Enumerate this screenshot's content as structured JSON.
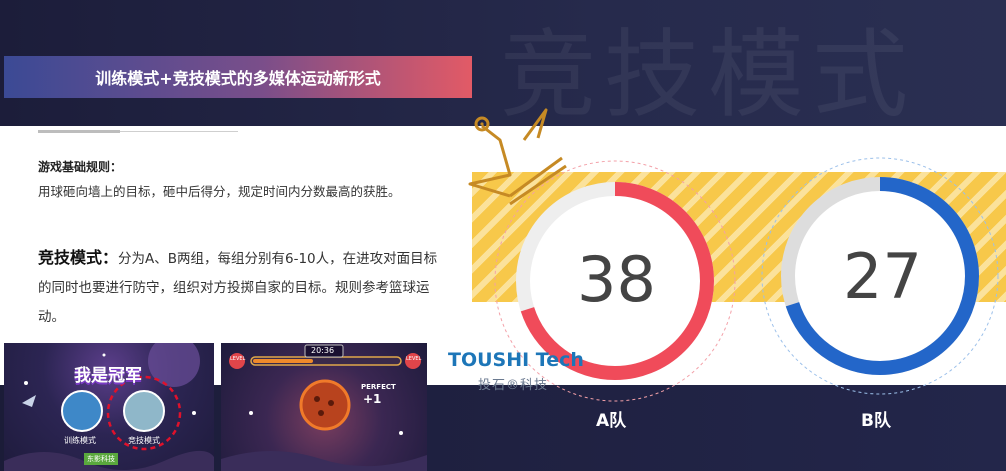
{
  "watermark": "竞技模式",
  "title_banner": "训练模式+竞技模式的多媒体运动新形式",
  "rules": {
    "heading": "游戏基础规则：",
    "body": "用球砸向墙上的目标，砸中后得分，规定时间内分数最高的获胜。"
  },
  "competition": {
    "label": "竞技模式：",
    "text": "分为A、B两组，每组分别有6-10人，在进攻对面目标的同时也要进行防守，组织对方投掷自家的目标。规则参考篮球运动。"
  },
  "thumbnails": {
    "thumb1": {
      "banner": "我是冠军",
      "left_label": "训练模式",
      "right_label": "竞技模式",
      "logo": "东影科技"
    },
    "thumb2": {
      "timer": "20:36",
      "bar_left": "LEVEL",
      "bar_right": "LEVEL",
      "perfect": "PERFECT",
      "bonus": "+1"
    }
  },
  "logo": {
    "en": "TOUSHI Tech",
    "cn": "投石®科技"
  },
  "teams": [
    {
      "name": "A队",
      "score": "38",
      "color": "#f04b5a",
      "track": "#eeeeee",
      "progress": 0.7
    },
    {
      "name": "B队",
      "score": "27",
      "color": "#2366c9",
      "track": "#dddddd",
      "progress": 0.7
    }
  ],
  "colors": {
    "accent_yellow": "#f7c84a",
    "crown": "#c68a24",
    "team_a": "#f04b5a",
    "team_b": "#2366c9"
  }
}
